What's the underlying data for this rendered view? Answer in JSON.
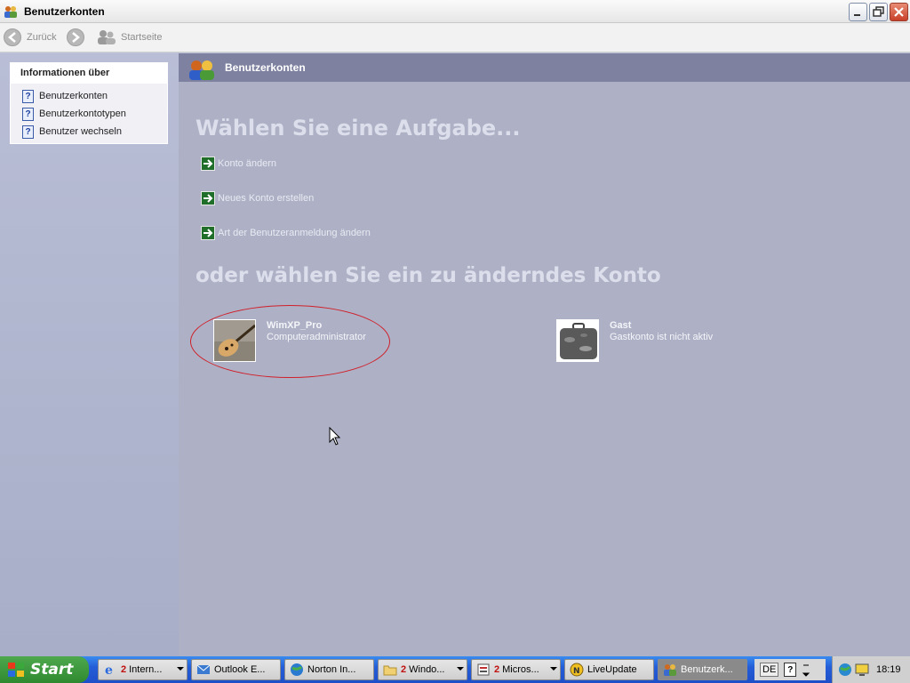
{
  "window": {
    "title": "Benutzerkonten",
    "icon": "users-icon"
  },
  "toolbar": {
    "back_label": "Zurück",
    "home_label": "Startseite"
  },
  "sidebar": {
    "header": "Informationen über",
    "links": [
      {
        "label": "Benutzerkonten",
        "icon": "help-icon"
      },
      {
        "label": "Benutzerkontotypen",
        "icon": "help-icon"
      },
      {
        "label": "Benutzer wechseln",
        "icon": "help-icon"
      }
    ]
  },
  "main": {
    "banner_title": "Benutzerkonten",
    "task_heading": "Wählen Sie eine Aufgabe...",
    "tasks": [
      {
        "label": "Konto ändern"
      },
      {
        "label": "Neues Konto erstellen"
      },
      {
        "label": "Art der Benutzeranmeldung ändern"
      }
    ],
    "account_heading": "oder wählen Sie ein zu änderndes Konto",
    "accounts": [
      {
        "name": "WimXP_Pro",
        "type": "Computeradministrator",
        "picture": "guitar-icon",
        "highlighted": true
      },
      {
        "name": "Gast",
        "type": "Gastkonto ist nicht aktiv",
        "picture": "suitcase-icon",
        "highlighted": false
      }
    ]
  },
  "taskbar": {
    "start_label": "Start",
    "buttons": [
      {
        "count": "2",
        "label": "Intern...",
        "icon": "ie-icon",
        "dropdown": true
      },
      {
        "count": "",
        "label": "Outlook E...",
        "icon": "outlook-icon",
        "dropdown": false
      },
      {
        "count": "",
        "label": "Norton In...",
        "icon": "globe-icon",
        "dropdown": false
      },
      {
        "count": "2",
        "label": "Windo...",
        "icon": "folder-icon",
        "dropdown": true
      },
      {
        "count": "2",
        "label": "Micros...",
        "icon": "app-icon",
        "dropdown": true
      },
      {
        "count": "",
        "label": "LiveUpdate",
        "icon": "liveupdate-icon",
        "dropdown": false
      },
      {
        "count": "",
        "label": "Benutzerk...",
        "icon": "users-icon",
        "dropdown": false,
        "active": true
      }
    ],
    "language": "DE",
    "clock": "18:19"
  },
  "colors": {
    "banner": "#7e82a0",
    "main_bg": "#aeb1c6",
    "taskbar": "#245ed8",
    "start": "#2f8a2f",
    "highlight_ellipse": "#d0202a"
  }
}
